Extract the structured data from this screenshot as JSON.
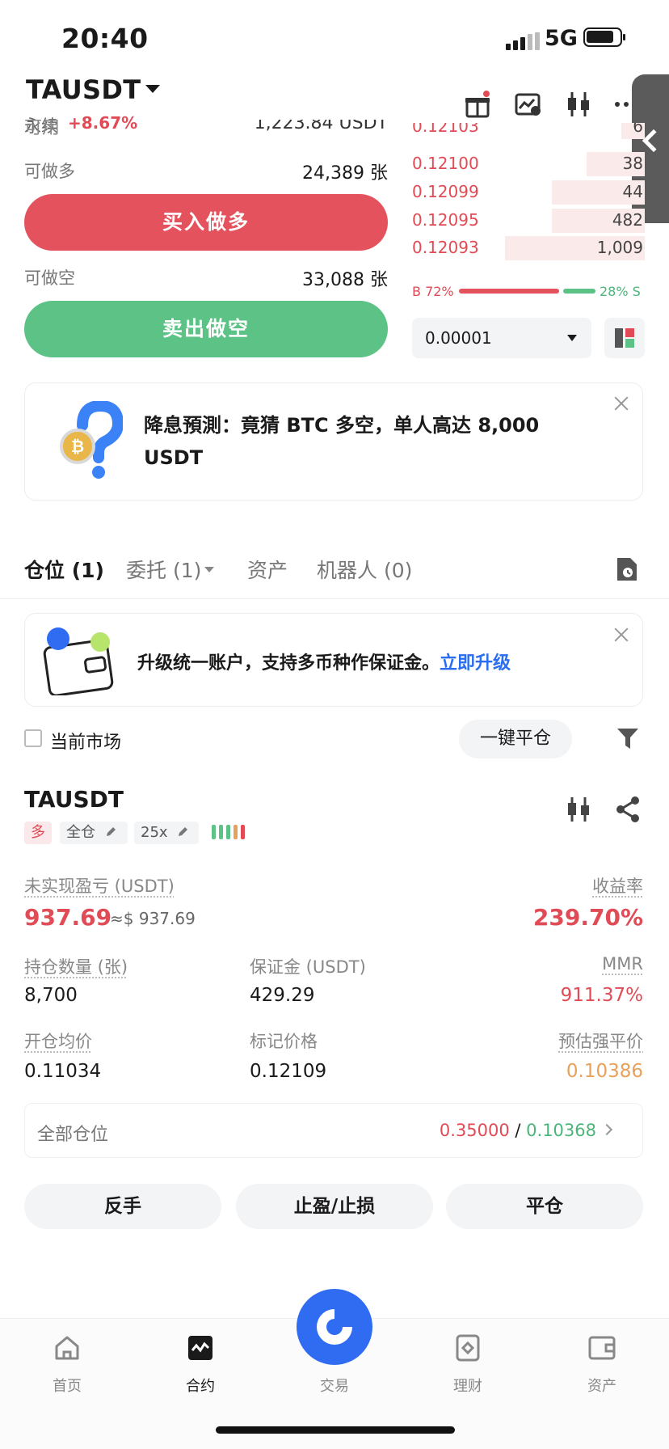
{
  "status_bar": {
    "time": "20:40",
    "network": "5G"
  },
  "header": {
    "symbol": "TAUSDT",
    "contract_type": "永续",
    "change": "+8.67%"
  },
  "trade_panel": {
    "available_cut": "1,223.84 USDT",
    "available_label_cut": "可用",
    "can_long_label": "可做多",
    "can_long_value": "24,389 张",
    "buy_long_label": "买入做多",
    "can_short_label": "可做空",
    "can_short_value": "33,088 张",
    "sell_short_label": "卖出做空"
  },
  "order_book": {
    "asks": [
      {
        "price": "0.12103",
        "qty": "6",
        "depth": 0.04
      },
      {
        "price": "0.12100",
        "qty": "38",
        "depth": 0.1
      },
      {
        "price": "0.12099",
        "qty": "44",
        "depth": 0.16
      },
      {
        "price": "0.12095",
        "qty": "482",
        "depth": 0.16
      },
      {
        "price": "0.12093",
        "qty": "1,009",
        "depth": 0.24
      }
    ],
    "buy_ratio": "B 72%",
    "sell_ratio": "28% S",
    "buy_fraction": 0.72,
    "precision": "0.00001"
  },
  "promo": {
    "text": "降息預測：竟猜 BTC 多空，单人高达 8,000 USDT"
  },
  "tabs": [
    {
      "label": "仓位 (1)"
    },
    {
      "label": "委托 (1)"
    },
    {
      "label": "资产"
    },
    {
      "label": "机器人 (0)"
    }
  ],
  "upgrade": {
    "text": "升级统一账户，支持多币种作保证金。",
    "link": "立即升级"
  },
  "filter": {
    "current_market": "当前市场",
    "close_all": "一键平仓"
  },
  "position": {
    "symbol": "TAUSDT",
    "side": "多",
    "margin_mode": "全仓",
    "leverage": "25x",
    "unrealized_pnl_label": "未实现盈亏 (USDT)",
    "unrealized_pnl": "937.69",
    "unrealized_pnl_usd": "≈$ 937.69",
    "roe_label": "收益率",
    "roe": "239.70%",
    "size_label": "持仓数量 (张)",
    "size": "8,700",
    "margin_label": "保证金 (USDT)",
    "margin": "429.29",
    "mmr_label": "MMR",
    "mmr": "911.37%",
    "entry_label": "开仓均价",
    "entry": "0.11034",
    "mark_label": "标记价格",
    "mark": "0.12109",
    "liq_label": "预估强平价",
    "liq": "0.10386",
    "all_positions_label": "全部仓位",
    "all_positions_high": "0.35000",
    "all_positions_sep": " / ",
    "all_positions_low": "0.10368",
    "actions": [
      "反手",
      "止盈/止损",
      "平仓"
    ]
  },
  "bottom_nav": [
    {
      "label": "首页",
      "icon": "home-icon"
    },
    {
      "label": "合约",
      "icon": "futures-icon"
    },
    {
      "label": "交易",
      "icon": "trade-icon"
    },
    {
      "label": "理财",
      "icon": "earn-icon"
    },
    {
      "label": "资产",
      "icon": "wallet-icon"
    }
  ],
  "colors": {
    "red": "#e14b55",
    "green": "#5cc285",
    "blue": "#2f6cf2",
    "orange": "#e7a15b"
  }
}
